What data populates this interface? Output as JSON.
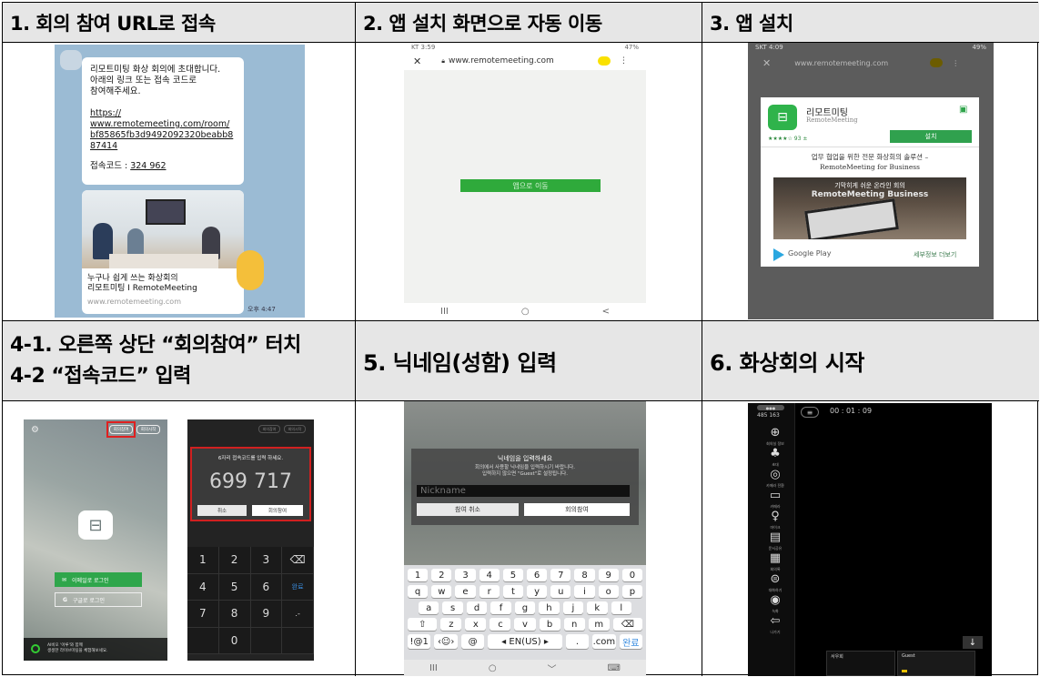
{
  "headers": {
    "h1": "1. 회의 참여 URL로 접속",
    "h2": "2. 앱 설치 화면으로 자동 이동",
    "h3": "3. 앱 설치",
    "h4_1": "4-1. 오른쪽 상단 “회의참여” 터치",
    "h4_2": "4-2 “접속코드” 입력",
    "h5": "5. 닉네임(성함) 입력",
    "h6": "6. 화상회의 시작"
  },
  "s1": {
    "msg_line1": "리모트미팅 화상 회의에 초대합니다.",
    "msg_line2": "아래의 링크 또는 접속 코드로",
    "msg_line3": "참여해주세요.",
    "link_lines": [
      "https://",
      "www.remotemeeting.com/room/",
      "bf85865fb3d9492092320beabb8",
      "87414"
    ],
    "code_label": "접속코드 : ",
    "code_value": "324 962",
    "preview_title1": "누구나 쉽게 쓰는 화상회의",
    "preview_title2": "리모트미팅 I RemoteMeeting",
    "preview_domain": "www.remotemeeting.com",
    "time": "오후 4:47"
  },
  "s2": {
    "status_left": "KT 3:59",
    "status_right": "47%",
    "url": "www.remotemeeting.com",
    "button": "앱으로 이동",
    "nav": [
      "III",
      "○",
      "<"
    ]
  },
  "s3": {
    "status_left": "SKT 4:09",
    "status_right": "49%",
    "url": "www.remotemeeting.com",
    "app_name": "리모트미팅",
    "developer": "RemoteMeeting",
    "rating": "★★★★☆ 93 ±",
    "install": "설치",
    "desc1": "업무 협업을 위한 전문 화상회의 솔루션 –",
    "desc2": "RemoteMeeting for Business",
    "banner_line1": "기막히게 쉬운 온라인 회의",
    "banner_line2": "RemoteMeeting Business",
    "store": "Google Play",
    "details": "세부정보 더보기"
  },
  "s4a": {
    "top_btn1": "회의참여",
    "top_btn2": "회의시작",
    "email_login": "이메일로 로그인",
    "google_login": "구글로 로그인",
    "promo1": "AI비오 '아루'와 함께",
    "promo2": "생생한 라이브미팅을 체험해보세요."
  },
  "s4b": {
    "top_btn1": "회의참여",
    "top_btn2": "회의시작",
    "prompt": "6자리 접속코드를 입력 하세요.",
    "code": "699 717",
    "cancel": "취소",
    "join": "회의참여",
    "keys": [
      "1",
      "2",
      "3",
      "⌫",
      "4",
      "5",
      "6",
      "완료",
      "7",
      "8",
      "9",
      ".-",
      "",
      "0",
      "",
      ""
    ]
  },
  "s5": {
    "title": "닉네임을 입력하세요",
    "desc1": "회의에서 사용할 닉네임을 입력하시기 바랍니다.",
    "desc2": "입력하지 않으면 \"Guest\"로 설정됩니다.",
    "placeholder": "Nickname",
    "cancel": "참여 취소",
    "join": "회의참여",
    "row1": [
      "1",
      "2",
      "3",
      "4",
      "5",
      "6",
      "7",
      "8",
      "9",
      "0"
    ],
    "row2": [
      "q",
      "w",
      "e",
      "r",
      "t",
      "y",
      "u",
      "i",
      "o",
      "p"
    ],
    "row3": [
      "a",
      "s",
      "d",
      "f",
      "g",
      "h",
      "j",
      "k",
      "l"
    ],
    "row4": [
      "⇧",
      "z",
      "x",
      "c",
      "v",
      "b",
      "n",
      "m",
      "⌫"
    ],
    "row5": [
      "!@1",
      "‹☺›",
      "@",
      "◂ EN(US) ▸",
      ".",
      ".com",
      "완료"
    ],
    "nav": [
      "III",
      "○",
      "﹀",
      "⌨"
    ]
  },
  "s6": {
    "room_badge": "●●●",
    "room_code": "485 163",
    "timer": "00 : 01 : 09",
    "side_items": [
      {
        "icon": "⊕",
        "label": "회의실 정보"
      },
      {
        "icon": "♣",
        "label": "초대"
      },
      {
        "icon": "◎",
        "label": "카메라 전환"
      },
      {
        "icon": "▭",
        "label": "카메라"
      },
      {
        "icon": "♀",
        "label": "마이크"
      },
      {
        "icon": "▤",
        "label": "문서공유"
      },
      {
        "icon": "▦",
        "label": "회의록"
      },
      {
        "icon": "⊜",
        "label": "대화하기"
      },
      {
        "icon": "◉",
        "label": "녹화"
      },
      {
        "icon": "⇦",
        "label": "나가기"
      }
    ],
    "down_arrow": "↓",
    "tile1": "서우희",
    "tile2": "Guest"
  }
}
